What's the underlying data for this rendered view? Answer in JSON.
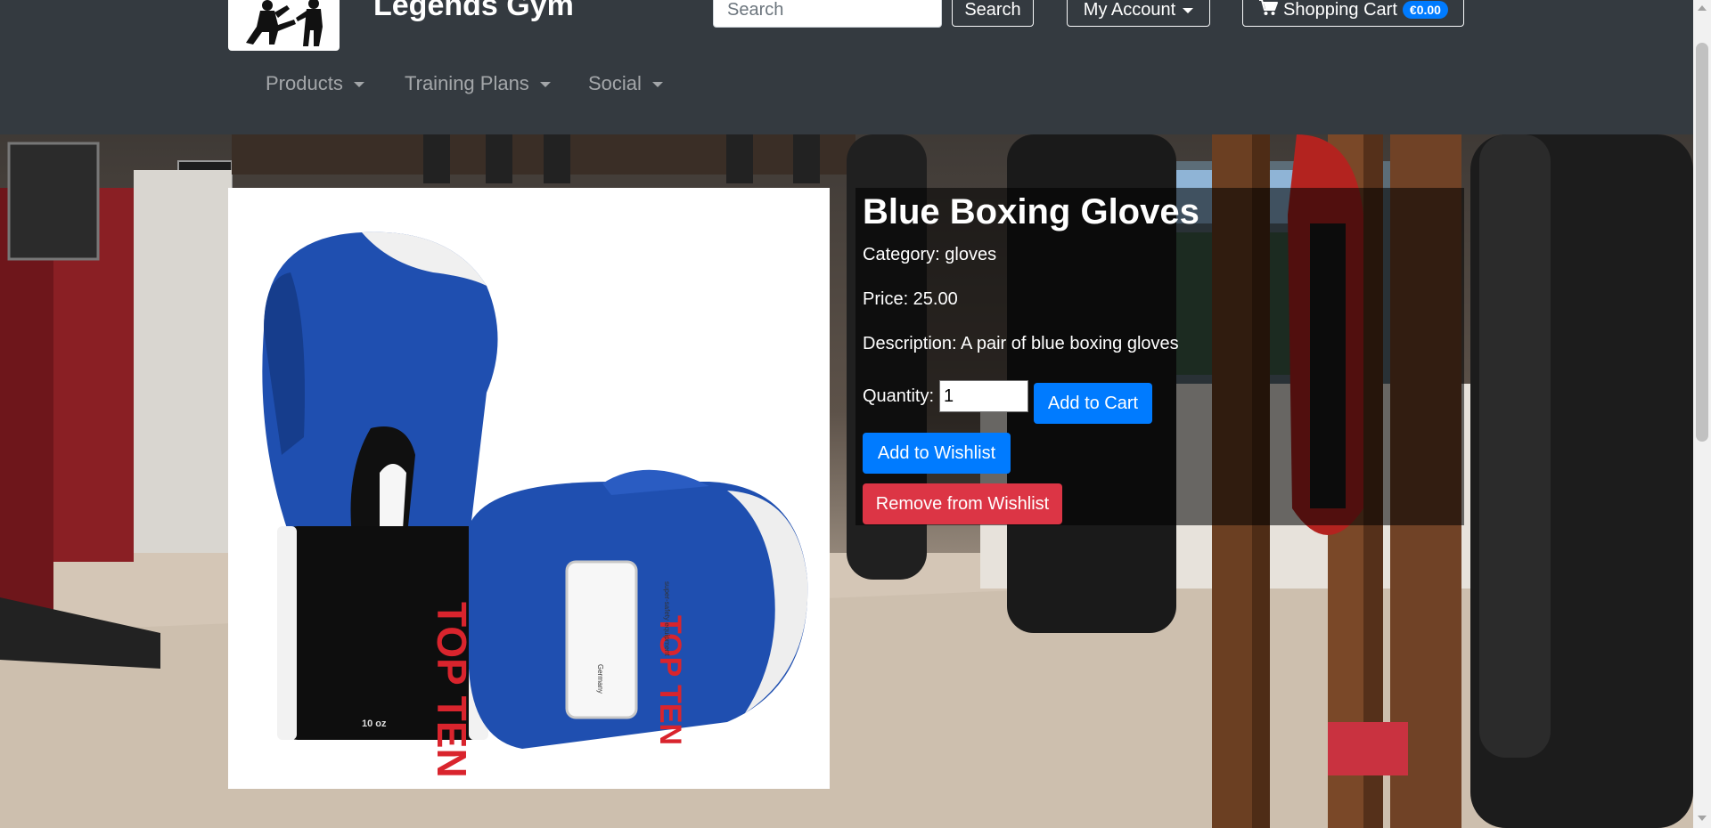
{
  "header": {
    "brand": "Legends Gym",
    "search": {
      "placeholder": "Search",
      "button_label": "Search"
    },
    "account_label": "My Account",
    "cart": {
      "label": "Shopping Cart",
      "total": "€0.00"
    },
    "nav": [
      "Products",
      "Training Plans",
      "Social"
    ]
  },
  "product": {
    "name": "Blue Boxing Gloves",
    "category_line": "Category: gloves",
    "price_line": "Price: 25.00",
    "description_line": "Description: A pair of blue boxing gloves",
    "quantity_label": "Quantity:",
    "quantity_value": "1",
    "add_to_cart_label": "Add to Cart",
    "add_to_wishlist_label": "Add to Wishlist",
    "remove_from_wishlist_label": "Remove from Wishlist",
    "image_text": {
      "brand_cuff": "TOP TEN",
      "brand_patch": "TOP TEN",
      "patch_small_1": "super-safety equipment",
      "patch_small_2": "Germany",
      "weight": "10 oz"
    }
  },
  "colors": {
    "navbar": "#343a40",
    "primary": "#007bff",
    "danger": "#dc3545",
    "glove_blue": "#1f4fb0"
  },
  "icons": {
    "cart": "cart-icon",
    "logo": "fighter-silhouette-logo"
  }
}
